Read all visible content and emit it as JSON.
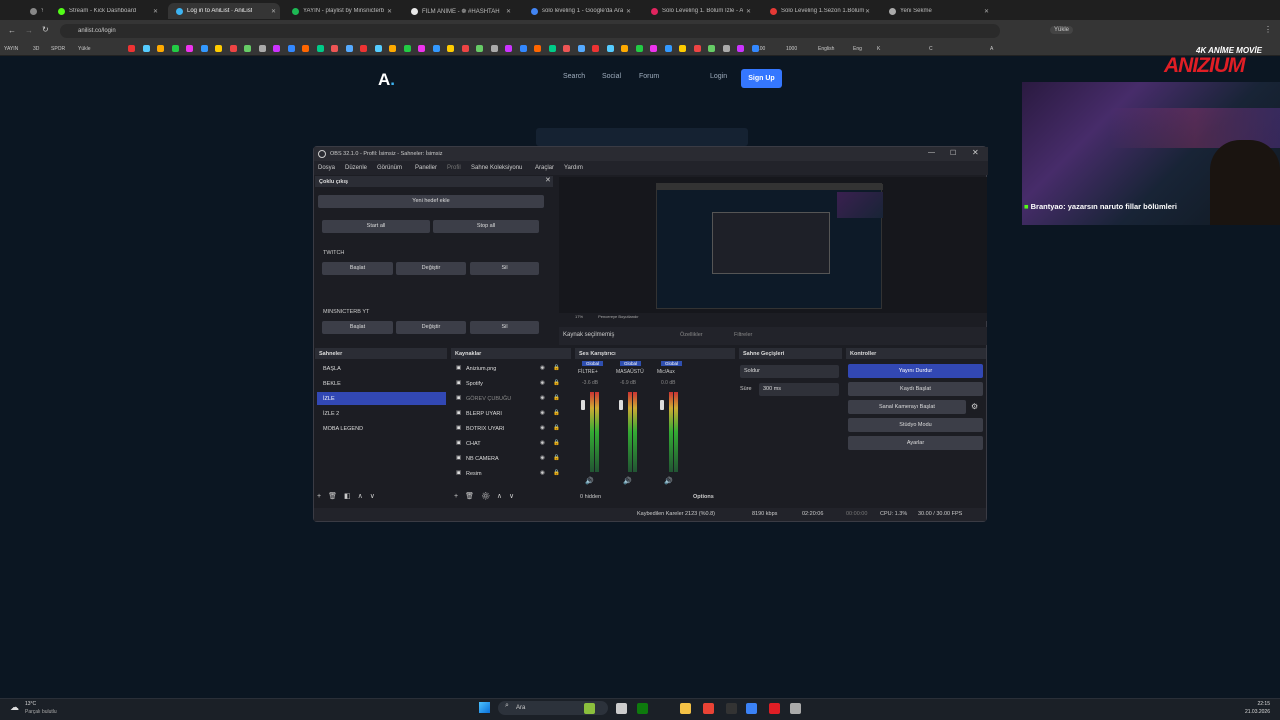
{
  "browser": {
    "tabs": [
      {
        "label": "YAYIN",
        "active": false,
        "color": "#888"
      },
      {
        "label": "Stream - Kick Dashboard",
        "active": false,
        "color": "#53fc18"
      },
      {
        "label": "Log in to AniList · AniList",
        "active": true,
        "color": "#3db4f2"
      },
      {
        "label": "YAYIN - playlist by Minsnicterb",
        "active": false,
        "color": "#1db954"
      },
      {
        "label": "FİLM ANİME - ❁ #HASHTAH",
        "active": false,
        "color": "#e8e8e8"
      },
      {
        "label": "solo leveling 1 - Google'da Ara",
        "active": false,
        "color": "#4285f4"
      },
      {
        "label": "Solo Leveling 1. Bölüm İzle - A",
        "active": false,
        "color": "#e0245e"
      },
      {
        "label": "Solo Leveling 1.Sezon 1.Bölüm",
        "active": false,
        "color": "#e53935"
      },
      {
        "label": "Yeni Sekme",
        "active": false,
        "color": "#aaa"
      }
    ],
    "url": "anilist.co/login",
    "bookmarks": [
      "YAYIN",
      "3D",
      "SPOR",
      "Yükle",
      "100",
      "1000",
      "English",
      "Eng",
      "K",
      "C",
      "A"
    ]
  },
  "site": {
    "logo": "A",
    "nav": [
      "Search",
      "Social",
      "Forum"
    ],
    "login": "Login",
    "signup": "Sign Up"
  },
  "obs": {
    "title": "OBS 32.1.0 - Profil: İsimsiz - Sahneler: İsimsiz",
    "menu": [
      "Dosya",
      "Düzenle",
      "Görünüm",
      "Paneller",
      "Profil",
      "Sahne Koleksiyonu",
      "Araçlar",
      "Yardım"
    ],
    "multi": {
      "header": "Çoklu çıkış",
      "add": "Yeni hedef ekle",
      "start_all": "Start all",
      "stop_all": "Stop all",
      "targets": [
        {
          "name": "TWITCH",
          "start": "Başlat",
          "edit": "Değiştir",
          "delete": "Sil"
        },
        {
          "name": "MINSNICTERB YT",
          "start": "Başlat",
          "edit": "Değiştir",
          "delete": "Sil"
        }
      ]
    },
    "preview_bar": {
      "zoom": "17%",
      "label": "Pencereye Boyutlandır"
    },
    "source_bar": {
      "status": "Kaynak seçilmemiş",
      "props": "Özellikler",
      "filters": "Filtreler"
    },
    "scenes": {
      "header": "Sahneler",
      "items": [
        "BAŞLA",
        "BEKLE",
        "İZLE",
        "İZLE 2",
        "MOBA LEGEND"
      ],
      "selected": 2
    },
    "sources": {
      "header": "Kaynaklar",
      "items": [
        "Anizium.png",
        "Spotify",
        "GÖREV ÇUBUĞU",
        "BLERP UYARI",
        "BOTRIX UYARI",
        "CHAT",
        "NB CAMERA",
        "Resim"
      ]
    },
    "mixer": {
      "header": "Ses Karıştırıcı",
      "channels": [
        {
          "name": "FİLTRE+",
          "tag": "Global",
          "db": "-3.6 dB"
        },
        {
          "name": "MASAÜSTÜ",
          "tag": "Global",
          "db": "-6.9 dB"
        },
        {
          "name": "Mic/Aux",
          "tag": "Global",
          "db": "0.0 dB"
        }
      ],
      "hidden": "0 hidden",
      "options": "Options"
    },
    "transitions": {
      "header": "Sahne Geçişleri",
      "type": "Soldur",
      "duration_label": "Süre",
      "duration": "300 ms"
    },
    "controls": {
      "header": "Kontroller",
      "stop": "Yayını Durdur",
      "record": "Kaydı Başlat",
      "vcam": "Sanal Kamerayı Başlat",
      "studio": "Stüdyo Modu",
      "settings": "Ayarlar"
    },
    "status": {
      "dropped": "Kaybedilen Kareler 2123 (%0.8)",
      "kbps": "8190 kbps",
      "stream_time": "02:20:06",
      "rec_time": "00:00:00",
      "cpu": "CPU: 1.3%",
      "fps": "30.00 / 30.00 FPS"
    }
  },
  "overlay": {
    "brand_top": "4K ANİME MOVİE",
    "brand": "ANIZIUM",
    "chat_user": "Brantyao",
    "chat_msg": ": yazarsın naruto fillar bölümleri"
  },
  "taskbar": {
    "weather_temp": "13°C",
    "weather_desc": "Parçalı bulutlu",
    "search": "Ara",
    "time": "22:15",
    "date": "21.03.2026"
  },
  "colors": {
    "accent": "#3577ff",
    "obs_selected": "#3248b4",
    "anilist": "#3db4f2"
  }
}
